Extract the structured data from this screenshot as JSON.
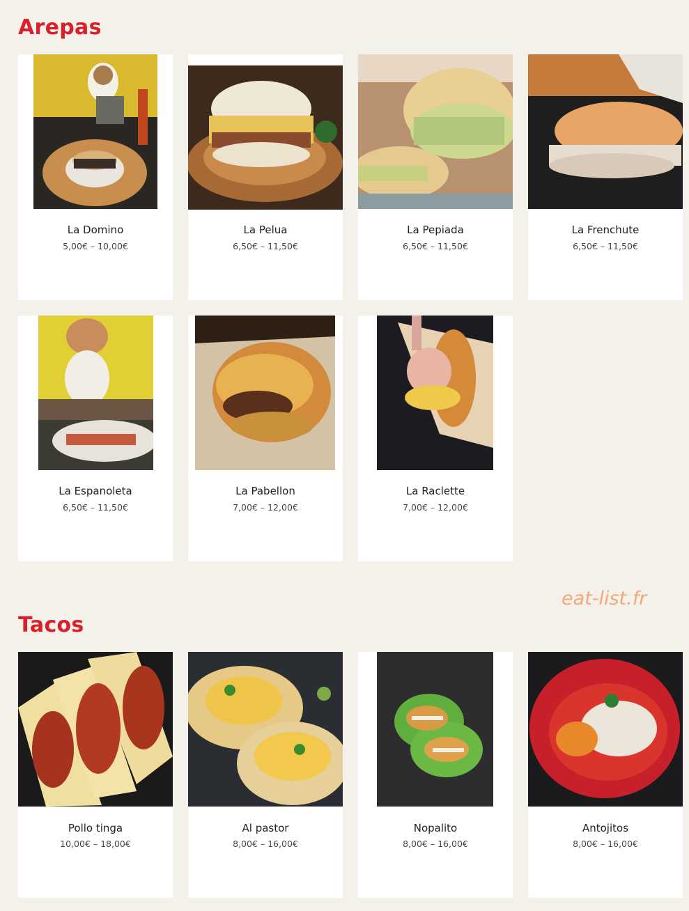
{
  "sections": {
    "arepas": {
      "title": "Arepas",
      "items": [
        {
          "name": "La Domino",
          "price": "5,00€ – 10,00€"
        },
        {
          "name": "La Pelua",
          "price": "6,50€ – 11,50€"
        },
        {
          "name": "La Pepiada",
          "price": "6,50€ – 11,50€"
        },
        {
          "name": "La Frenchute",
          "price": "6,50€ – 11,50€"
        },
        {
          "name": "La Espanoleta",
          "price": "6,50€ – 11,50€"
        },
        {
          "name": "La Pabellon",
          "price": "7,00€ – 12,00€"
        },
        {
          "name": "La Raclette",
          "price": "7,00€ – 12,00€"
        }
      ]
    },
    "tacos": {
      "title": "Tacos",
      "items": [
        {
          "name": "Pollo tinga",
          "price": "10,00€ – 18,00€"
        },
        {
          "name": "Al pastor",
          "price": "8,00€ – 16,00€"
        },
        {
          "name": "Nopalito",
          "price": "8,00€ – 16,00€"
        },
        {
          "name": "Antojitos",
          "price": "8,00€ – 16,00€"
        }
      ]
    }
  },
  "watermark": "eat-list.fr",
  "colors": {
    "background": "#f4f0ea",
    "title": "#d8212b",
    "card": "#ffffff",
    "watermark": "#f2a97a"
  }
}
